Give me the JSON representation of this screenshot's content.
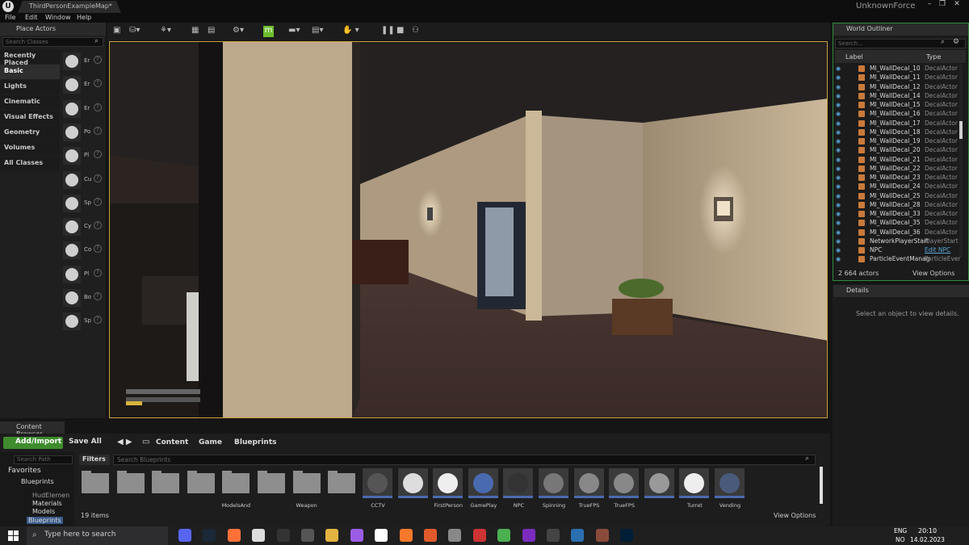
{
  "window": {
    "tab_title": "ThirdPersonExampleMap*",
    "user": "UnknownForce",
    "menu": [
      "File",
      "Edit",
      "Window",
      "Help"
    ]
  },
  "place_actors": {
    "title": "Place Actors",
    "search_placeholder": "Search Classes",
    "categories": [
      "Recently Placed",
      "Basic",
      "Lights",
      "Cinematic",
      "Visual Effects",
      "Geometry",
      "Volumes",
      "All Classes"
    ],
    "active_category": "Basic",
    "actors": [
      "Er",
      "Er",
      "Er",
      "Po",
      "Pl",
      "Cu",
      "Sp",
      "Cy",
      "Co",
      "Pl",
      "Bo",
      "Sp"
    ]
  },
  "outliner": {
    "title": "World Outliner",
    "search_placeholder": "Search...",
    "col_label": "Label",
    "col_type": "Type",
    "rows": [
      {
        "label": "MI_WallDecal_10",
        "type": "DecalActor"
      },
      {
        "label": "MI_WallDecal_11",
        "type": "DecalActor"
      },
      {
        "label": "MI_WallDecal_12",
        "type": "DecalActor"
      },
      {
        "label": "MI_WallDecal_14",
        "type": "DecalActor"
      },
      {
        "label": "MI_WallDecal_15",
        "type": "DecalActor"
      },
      {
        "label": "MI_WallDecal_16",
        "type": "DecalActor"
      },
      {
        "label": "MI_WallDecal_17",
        "type": "DecalActor"
      },
      {
        "label": "MI_WallDecal_18",
        "type": "DecalActor"
      },
      {
        "label": "MI_WallDecal_19",
        "type": "DecalActor"
      },
      {
        "label": "MI_WallDecal_20",
        "type": "DecalActor"
      },
      {
        "label": "MI_WallDecal_21",
        "type": "DecalActor"
      },
      {
        "label": "MI_WallDecal_22",
        "type": "DecalActor"
      },
      {
        "label": "MI_WallDecal_23",
        "type": "DecalActor"
      },
      {
        "label": "MI_WallDecal_24",
        "type": "DecalActor"
      },
      {
        "label": "MI_WallDecal_25",
        "type": "DecalActor"
      },
      {
        "label": "MI_WallDecal_28",
        "type": "DecalActor"
      },
      {
        "label": "MI_WallDecal_33",
        "type": "DecalActor"
      },
      {
        "label": "MI_WallDecal_35",
        "type": "DecalActor"
      },
      {
        "label": "MI_WallDecal_36",
        "type": "DecalActor"
      },
      {
        "label": "NetworkPlayerStart",
        "type": "PlayerStart"
      },
      {
        "label": "NPC",
        "type": "Edit NPC"
      },
      {
        "label": "ParticleEventManag",
        "type": "ParticleEver"
      }
    ],
    "actor_count": "2 664 actors",
    "view_options": "View Options"
  },
  "details": {
    "title": "Details",
    "message": "Select an object to view details."
  },
  "content_browser": {
    "tab": "Content Browser",
    "add_import": "Add/Import",
    "save_all": "Save All",
    "breadcrumbs": [
      "Content",
      "Game",
      "Blueprints"
    ],
    "path_search_placeholder": "Search Path",
    "tree": [
      "Favorites",
      "Blueprints",
      "HudElemen",
      "Materials",
      "Models",
      "Blueprints"
    ],
    "filters": "Filters",
    "asset_search_placeholder": "Search Blueprints",
    "folder_labels": [
      "",
      "",
      "",
      "",
      "ModelsAnd",
      "",
      "Weapon",
      ""
    ],
    "assets": [
      {
        "label": "CCTV",
        "color": "#555"
      },
      {
        "label": "",
        "color": "#ddd"
      },
      {
        "label": "FirstPerson",
        "color": "#eee"
      },
      {
        "label": "GamePlay",
        "color": "#4a6ab0"
      },
      {
        "label": "NPC",
        "color": "#333"
      },
      {
        "label": "Spinning",
        "color": "#777"
      },
      {
        "label": "TrueFPS",
        "color": "#888"
      },
      {
        "label": "TrueFPS",
        "color": "#888"
      },
      {
        "label": "",
        "color": "#999"
      },
      {
        "label": "Turret",
        "color": "#eee"
      },
      {
        "label": "Vending",
        "color": "#4a5a7a"
      }
    ],
    "item_count": "19 items",
    "view_options": "View Options"
  },
  "taskbar": {
    "search_placeholder": "Type here to search",
    "lang_top": "ENG",
    "lang_bottom": "NO",
    "time": "20:10",
    "date": "14.02.2023",
    "apps": [
      "discord-icon",
      "steam-icon",
      "firefox-icon",
      "unreal-icon",
      "epic-icon",
      "obs-icon",
      "folder-icon",
      "github-icon",
      "capcut-icon",
      "blender-icon",
      "substance-icon",
      "tool-icon",
      "paint-icon",
      "settings-icon",
      "tor-icon",
      "ref-icon",
      "cz-icon",
      "avatar-icon",
      "photoshop-icon"
    ],
    "app_colors": [
      "#5865f2",
      "#1b2838",
      "#ff7139",
      "#ddd",
      "#333",
      "#555",
      "#e3b341",
      "#9b5de5",
      "#fff",
      "#f5792a",
      "#e05a2b",
      "#888",
      "#c33",
      "#4caf50",
      "#7b2cbf",
      "#444",
      "#2a6fb0",
      "#8a4a3a",
      "#001e36"
    ]
  }
}
